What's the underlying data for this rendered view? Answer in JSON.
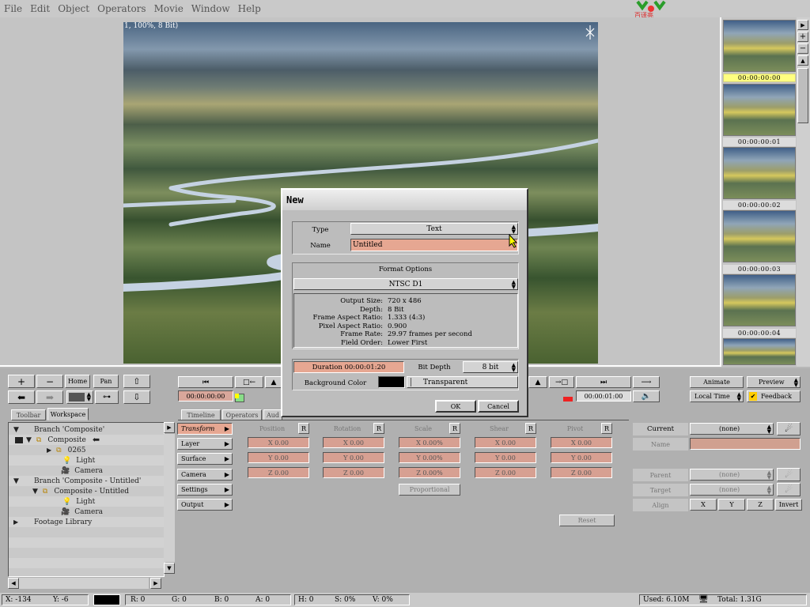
{
  "menu": [
    "File",
    "Edit",
    "Object",
    "Operators",
    "Movie",
    "Window",
    "Help"
  ],
  "logo_text": "百译亮",
  "viewer": {
    "caption": "1, 100%, 8 Bit)"
  },
  "thumbnails": [
    "00:00:00:00",
    "00:00:00:01",
    "00:00:00:02",
    "00:00:00:03",
    "00:00:00:04"
  ],
  "nav": {
    "home": "Home",
    "pan": "Pan",
    "plus": "+",
    "minus": "−"
  },
  "transport": {
    "current_time": "00:00:00:00",
    "end_time": "00:00:01:00"
  },
  "right_controls": {
    "animate": "Animate",
    "preview": "Preview",
    "local_time": "Local Time",
    "feedback": "Feedback"
  },
  "tabs": {
    "toolbar": "Toolbar",
    "workspace": "Workspace",
    "timeline": "Timeline",
    "operators": "Operators",
    "audio": "Aud"
  },
  "tree": [
    {
      "label": "Branch 'Composite'",
      "indent": 0
    },
    {
      "label": "Composite",
      "indent": 1
    },
    {
      "label": "0265",
      "indent": 2
    },
    {
      "label": "Light",
      "indent": 2
    },
    {
      "label": "Camera",
      "indent": 2
    },
    {
      "label": "Branch 'Composite - Untitled'",
      "indent": 0
    },
    {
      "label": "Composite - Untitled",
      "indent": 1
    },
    {
      "label": "Light",
      "indent": 2
    },
    {
      "label": "Camera",
      "indent": 2
    },
    {
      "label": "Footage Library",
      "indent": 0
    }
  ],
  "categories": [
    "Transform",
    "Layer",
    "Surface",
    "Camera",
    "Settings",
    "Output"
  ],
  "transform": {
    "headers": [
      "Position",
      "Rotation",
      "Scale",
      "Shear",
      "Pivot"
    ],
    "reset_key": "R",
    "rows": [
      [
        "X 0.00",
        "X 0.00",
        "X 0.00%",
        "X 0.00",
        "X 0.00"
      ],
      [
        "Y 0.00",
        "Y 0.00",
        "Y 0.00%",
        "Y 0.00",
        "Y 0.00"
      ],
      [
        "Z 0.00",
        "Z 0.00",
        "Z 0.00%",
        "Z 0.00",
        "Z 0.00"
      ]
    ],
    "proportional": "Proportional",
    "reset": "Reset"
  },
  "object_props": {
    "current_label": "Current",
    "current_value": "(none)",
    "name_label": "Name",
    "parent_label": "Parent",
    "parent_value": "(none)",
    "target_label": "Target",
    "target_value": "(none)",
    "align_label": "Align",
    "align_buttons": [
      "X",
      "Y",
      "Z",
      "Invert"
    ]
  },
  "status": {
    "x": "X:  -134",
    "y": "Y:  -6",
    "r": "R: 0",
    "g": "G: 0",
    "b": "B: 0",
    "a": "A: 0",
    "h": "H: 0",
    "s": "S: 0%",
    "v": "V: 0%",
    "used": "Used: 6.10M",
    "total": "Total: 1.31G"
  },
  "dialog": {
    "title": "New",
    "type_label": "Type",
    "type_value": "Text",
    "name_label": "Name",
    "name_value": "Untitled",
    "format_options": "Format Options",
    "format_value": "NTSC D1",
    "info": [
      {
        "k": "Output Size:",
        "v": "720 x 486"
      },
      {
        "k": "Depth:",
        "v": "8 Bit"
      },
      {
        "k": "Frame Aspect Ratio:",
        "v": "1.333  (4:3)"
      },
      {
        "k": "Pixel Aspect Ratio:",
        "v": "0.900"
      },
      {
        "k": "Frame Rate:",
        "v": "29.97 frames per second"
      },
      {
        "k": "Field Order:",
        "v": "Lower First"
      }
    ],
    "duration": "Duration 00:00:01:20",
    "bit_depth_label": "Bit Depth",
    "bit_depth_value": "8 bit",
    "bg_color_label": "Background Color",
    "bg_color": "#000000",
    "transparent": "Transparent",
    "ok": "OK",
    "cancel": "Cancel"
  },
  "colors": {
    "accent": "#e6a792",
    "selection": "#ffff55",
    "panel": "#b0b0b0"
  }
}
